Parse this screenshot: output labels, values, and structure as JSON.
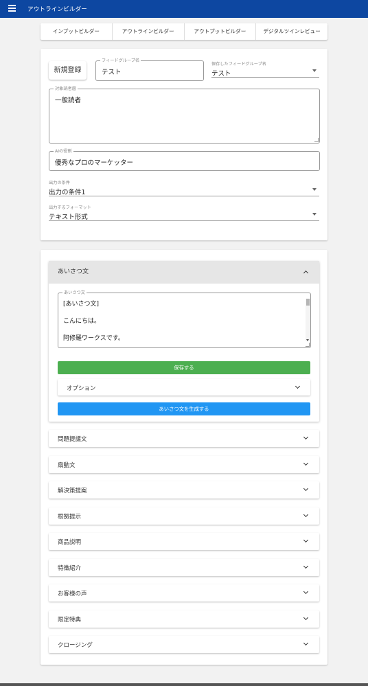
{
  "appbar": {
    "title": "アウトラインビルダー",
    "menu_icon": "menu-icon"
  },
  "tabs": [
    "インプットビルダー",
    "アウトラインビルダー",
    "アウトプットビルダー",
    "デジタルツインレビュー"
  ],
  "form": {
    "new_button": "新規登録",
    "feed_group_name": {
      "label": "フィードグループ名",
      "value": "テスト"
    },
    "saved_feed_group": {
      "label": "保存したフィードグループ名",
      "value": "テスト"
    },
    "target_reader": {
      "label": "対象読者層",
      "value": "一般読者"
    },
    "ai_role": {
      "label": "AIの役割",
      "value": "優秀なプロのマーケッター"
    },
    "output_condition": {
      "label": "出力の条件",
      "value": "出力の条件1"
    },
    "output_format": {
      "label": "出力するフォーマット",
      "value": "テキスト形式"
    }
  },
  "sections": {
    "open": {
      "title": "あいさつ文",
      "textarea_label": "あいさつ文",
      "lines": [
        "[あいさつ文]",
        "こんにちは。",
        "阿修羅ワークスです。"
      ],
      "save_button": "保存する",
      "options_label": "オプション",
      "generate_button": "あいさつ文を生成する"
    },
    "collapsed": [
      "問題提議文",
      "扇動文",
      "解決策提案",
      "根拠提示",
      "商品説明",
      "特徴紹介",
      "お客様の声",
      "限定特典",
      "クロージング"
    ]
  },
  "colors": {
    "appbar": "#0d47a1",
    "save": "#4caf50",
    "generate": "#2196f3"
  }
}
